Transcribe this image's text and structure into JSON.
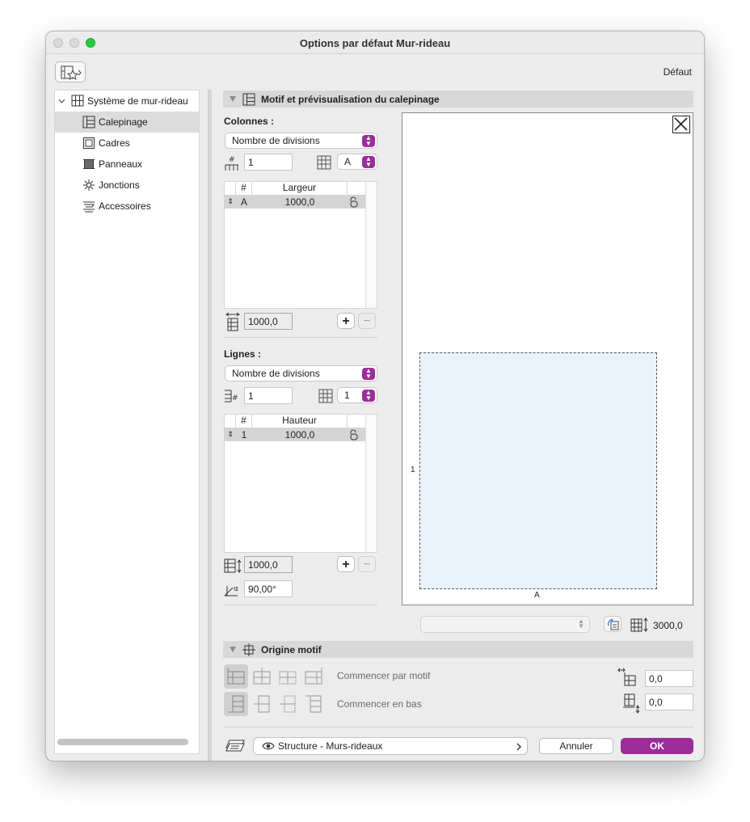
{
  "window": {
    "title": "Options par défaut Mur-rideau"
  },
  "toolbar": {
    "preset_label": "Défaut"
  },
  "sidebar": {
    "items": [
      {
        "label": "Système de mur-rideau",
        "icon": "curtain-wall-icon",
        "expanded": true
      },
      {
        "label": "Calepinage",
        "icon": "scheme-icon",
        "selected": true
      },
      {
        "label": "Cadres",
        "icon": "frame-icon"
      },
      {
        "label": "Panneaux",
        "icon": "panel-icon"
      },
      {
        "label": "Jonctions",
        "icon": "junction-icon"
      },
      {
        "label": "Accessoires",
        "icon": "accessory-icon"
      }
    ]
  },
  "scheme_section": {
    "title": "Motif et prévisualisation du calepinage",
    "columns": {
      "label": "Colonnes :",
      "mode": "Nombre de divisions",
      "count": "1",
      "letter": "A",
      "headers": [
        "#",
        "Largeur"
      ],
      "rows": [
        {
          "id": "A",
          "value": "1000,0"
        }
      ],
      "total": "1000,0"
    },
    "rows": {
      "label": "Lignes :",
      "mode": "Nombre de divisions",
      "count": "1",
      "number": "1",
      "headers": [
        "#",
        "Hauteur"
      ],
      "rows": [
        {
          "id": "1",
          "value": "1000,0"
        }
      ],
      "total": "1000,0",
      "angle": "90,00°"
    },
    "preview": {
      "row_label": "1",
      "col_label": "A",
      "height_value": "3000,0",
      "pane_color": "#eaf3fc"
    }
  },
  "origin_section": {
    "title": "Origine motif",
    "start_by_pattern": "Commencer par motif",
    "start_bottom": "Commencer en bas",
    "offset_x": "0,0",
    "offset_y": "0,0"
  },
  "footer": {
    "view_label": "Structure - Murs-rideaux",
    "cancel": "Annuler",
    "ok": "OK",
    "accent": "#9b2d9b"
  }
}
